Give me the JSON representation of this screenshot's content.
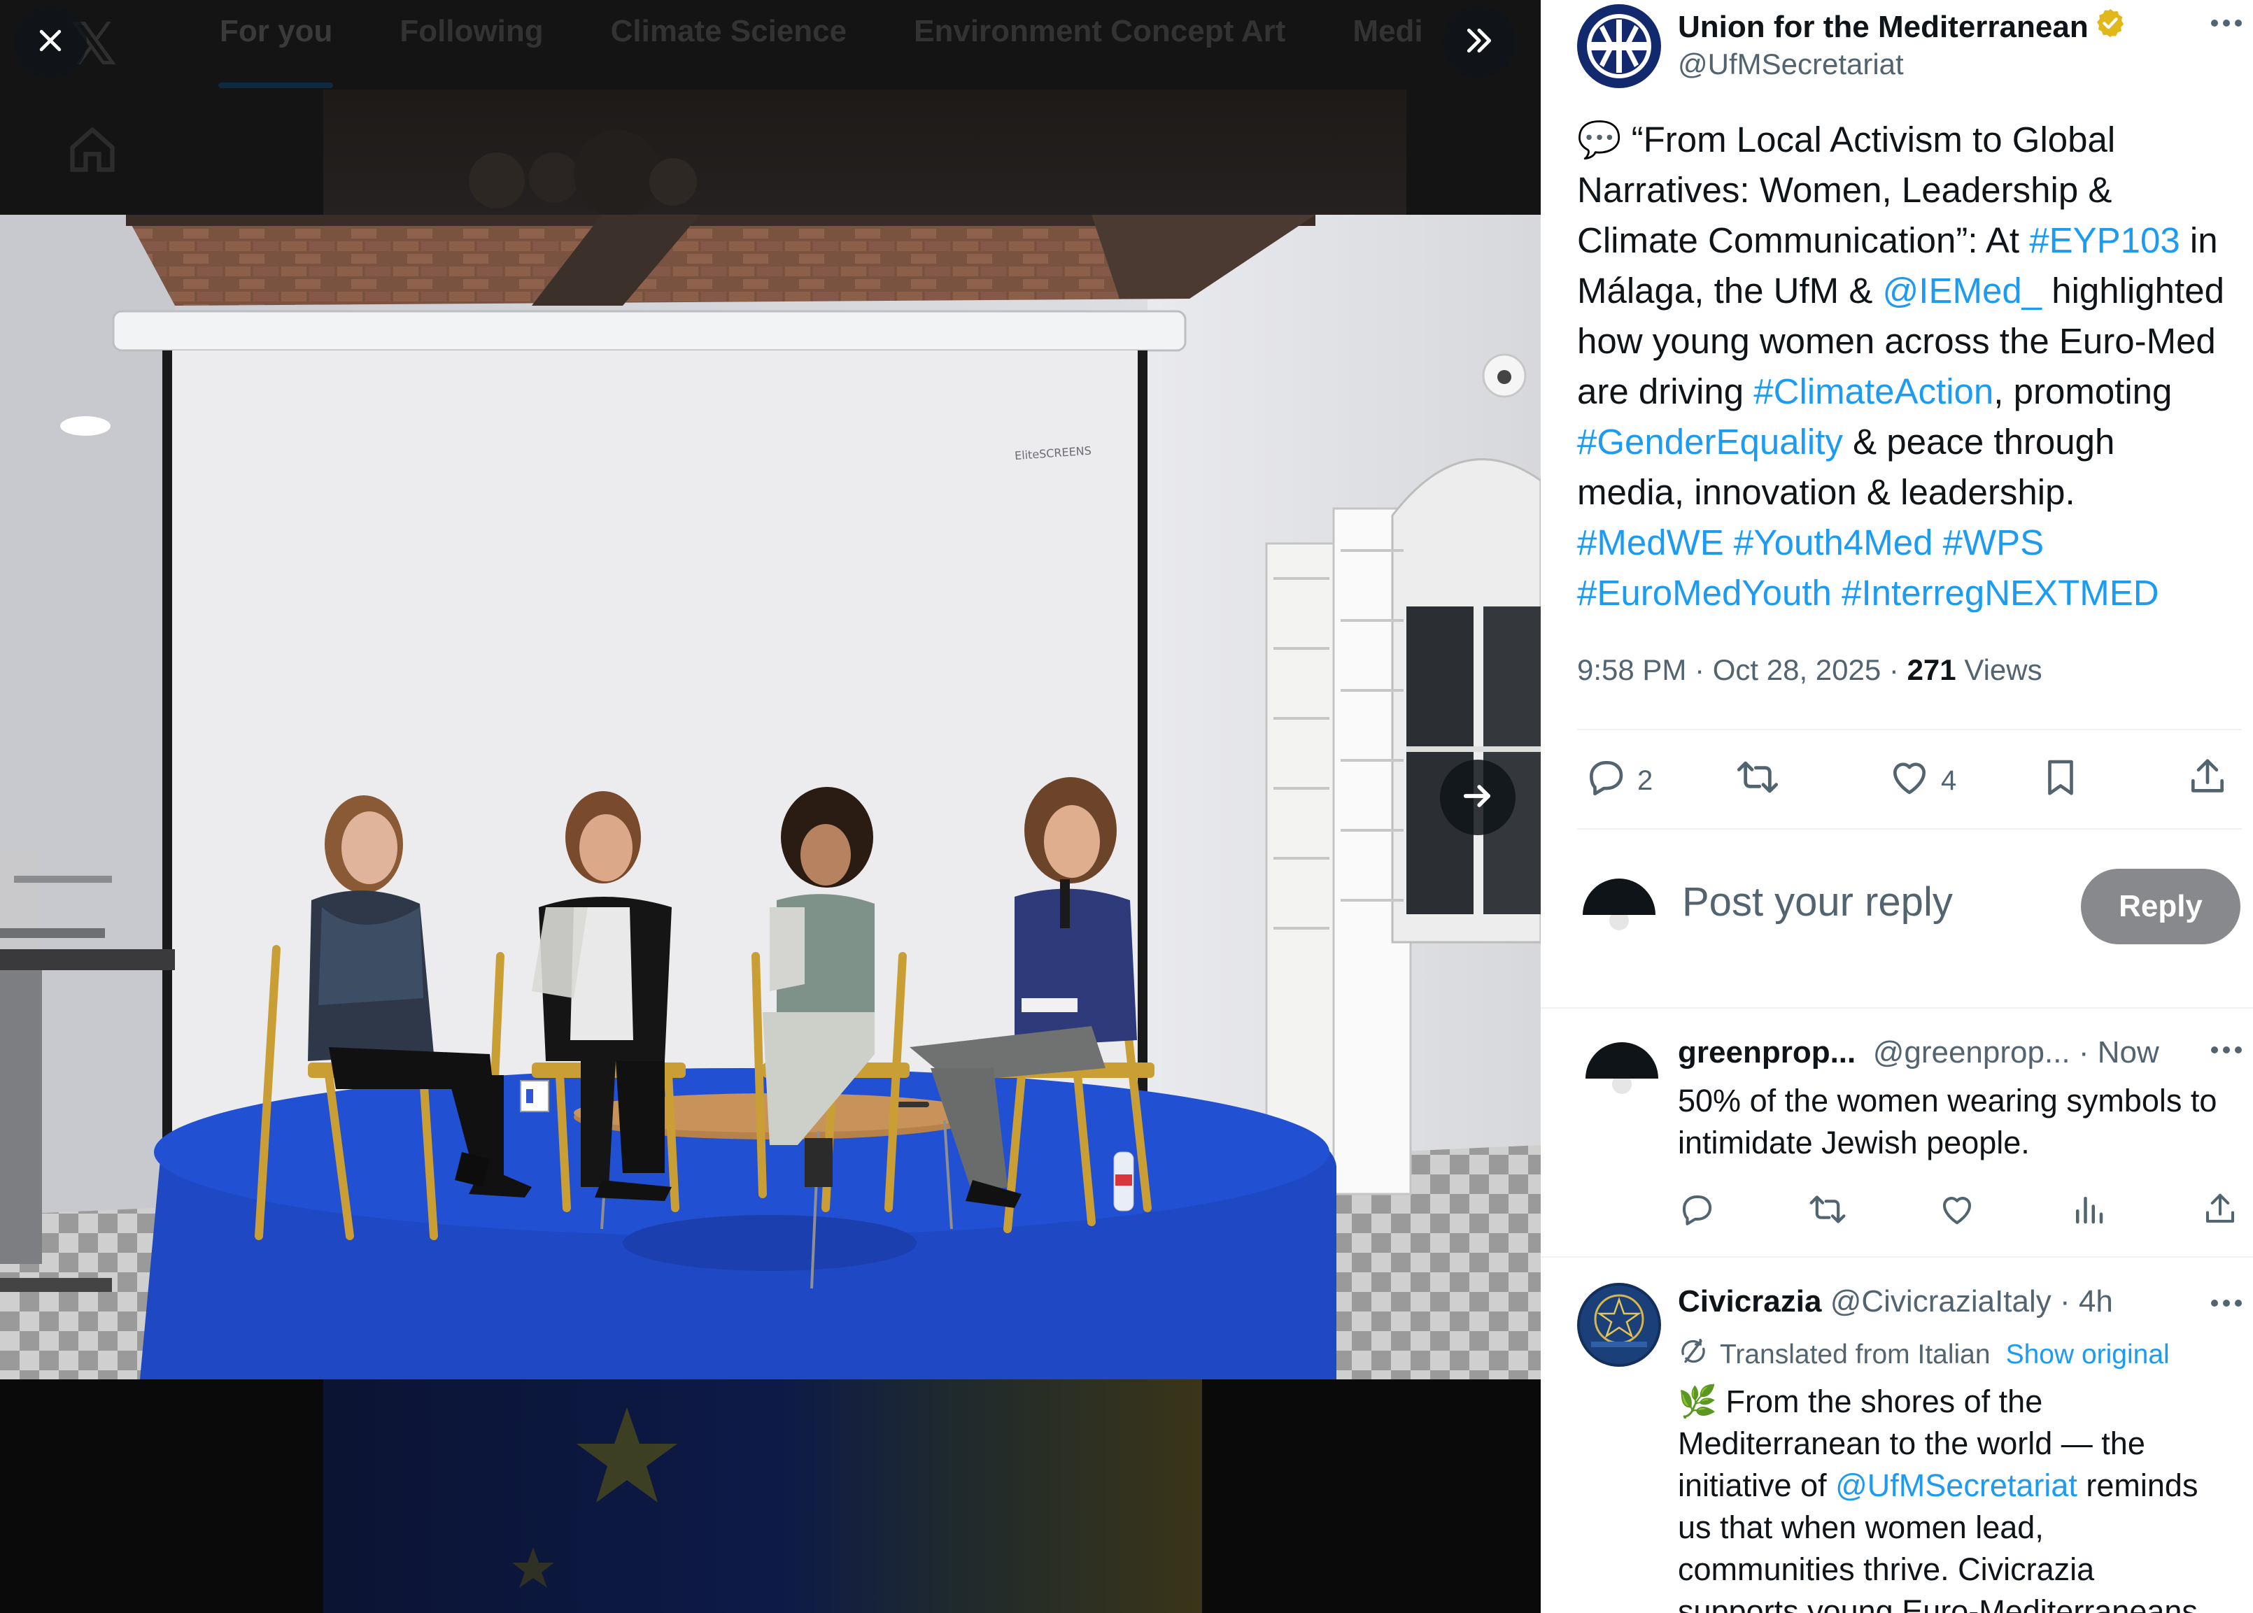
{
  "background": {
    "logo": "𝕏",
    "tabs": [
      "For you",
      "Following",
      "Climate Science",
      "Environment Concept Art",
      "Medi"
    ]
  },
  "media": {
    "close_icon": "close-icon",
    "expand_icon": "double-chevron-right-icon",
    "next_icon": "arrow-right-icon",
    "screen_brand": "EliteSCREENS"
  },
  "tweet": {
    "author": {
      "name": "Union for the Mediterranean",
      "handle": "@UfMSecretariat",
      "verified": true,
      "verified_color": "#e2b719"
    },
    "lines": [
      [
        {
          "t": "💬 “From Local Activism to Global"
        }
      ],
      [
        {
          "t": "Narratives: Women, Leadership &"
        }
      ],
      [
        {
          "t": "Climate Communication”: At "
        },
        {
          "t": "#EYP103",
          "link": true
        },
        {
          "t": " in"
        }
      ],
      [
        {
          "t": "Málaga, the UfM & "
        },
        {
          "t": "@IEMed_",
          "link": true
        },
        {
          "t": " highlighted"
        }
      ],
      [
        {
          "t": "how young women across the Euro-Med"
        }
      ],
      [
        {
          "t": "are driving "
        },
        {
          "t": "#ClimateAction",
          "link": true
        },
        {
          "t": ", promoting"
        }
      ],
      [
        {
          "t": "#GenderEquality",
          "link": true
        },
        {
          "t": " & peace through"
        }
      ],
      [
        {
          "t": "media, innovation & leadership."
        }
      ],
      [
        {
          "t": "#MedWE",
          "link": true
        },
        {
          "t": " "
        },
        {
          "t": "#Youth4Med",
          "link": true
        },
        {
          "t": " "
        },
        {
          "t": "#WPS",
          "link": true
        }
      ],
      [
        {
          "t": "#EuroMedYouth",
          "link": true
        },
        {
          "t": " "
        },
        {
          "t": "#InterregNEXTMED",
          "link": true
        }
      ]
    ],
    "time": "9:58 PM",
    "date": "Oct 28, 2025",
    "views_count": "271",
    "views_label": "Views",
    "stats": {
      "replies": "2",
      "reposts": "",
      "likes": "4"
    }
  },
  "reply_box": {
    "placeholder": "Post your reply",
    "button": "Reply"
  },
  "comments": [
    {
      "name": "greenprop...",
      "handle": "@greenprop...",
      "time": "Now",
      "lines": [
        [
          {
            "t": "50% of the women wearing symbols to"
          }
        ],
        [
          {
            "t": "intimidate Jewish people."
          }
        ]
      ]
    },
    {
      "name": "Civicrazia",
      "handle": "@CivicraziaItaly",
      "time": "4h",
      "translated_label": "Translated from Italian",
      "show_original": "Show original",
      "lines": [
        [
          {
            "t": "🌿 From the shores of the"
          }
        ],
        [
          {
            "t": "Mediterranean to the world — the"
          }
        ],
        [
          {
            "t": "initiative of "
          },
          {
            "t": "@UfMSecretariat",
            "link": true
          },
          {
            "t": " reminds"
          }
        ],
        [
          {
            "t": "us that when women lead,"
          }
        ],
        [
          {
            "t": "communities thrive. Civicrazia"
          }
        ],
        [
          {
            "t": "supports young Euro-Mediterraneans"
          }
        ]
      ]
    }
  ],
  "colors": {
    "link": "#1d9bf0",
    "text": "#0f1419",
    "muted": "#536471",
    "reply_button": "#87898c",
    "stage_blue": "#1f49c4"
  }
}
